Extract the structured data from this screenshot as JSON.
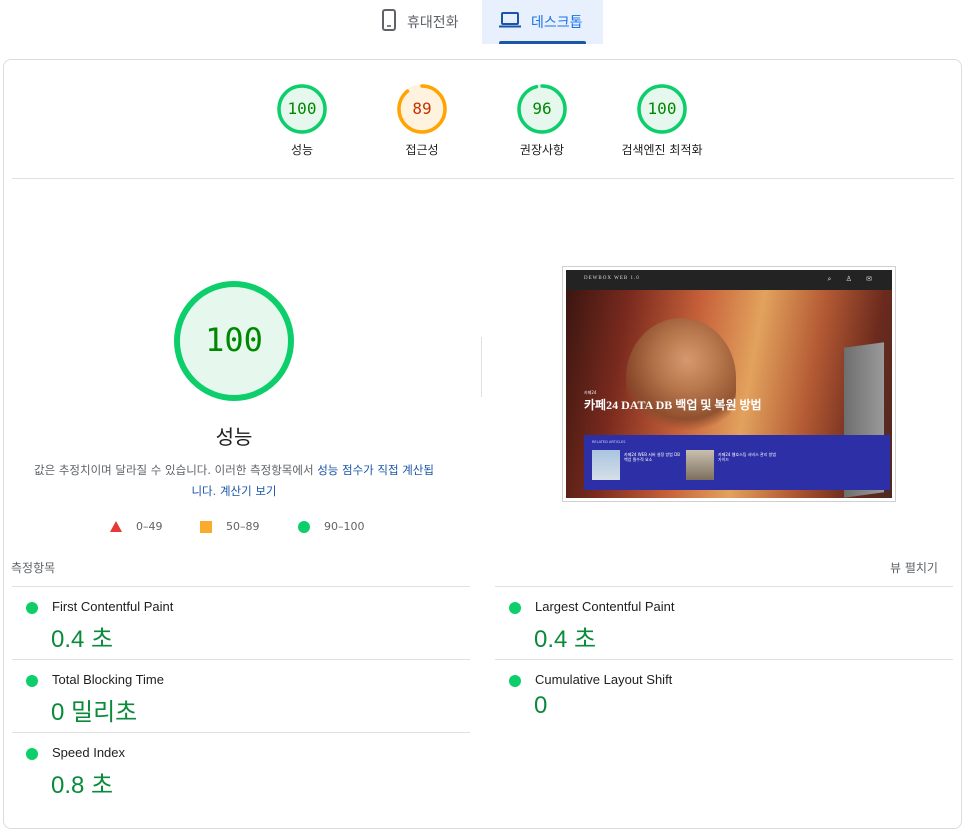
{
  "tabs": [
    {
      "label": "휴대전화",
      "icon": "mobile-phone-icon",
      "selected": false
    },
    {
      "label": "데스크톱",
      "icon": "laptop-icon",
      "selected": true
    }
  ],
  "gauges": [
    {
      "value": "100",
      "label": "성능",
      "color": "#0cce6b",
      "track": "#e6f8ee",
      "text": "#008800",
      "fraction": 1.0
    },
    {
      "value": "89",
      "label": "접근성",
      "color": "#ffa400",
      "track": "#fff3e0",
      "text": "#c33300",
      "fraction": 0.89
    },
    {
      "value": "96",
      "label": "권장사항",
      "color": "#0cce6b",
      "track": "#e6f8ee",
      "text": "#008800",
      "fraction": 0.96
    },
    {
      "value": "100",
      "label": "검색엔진 최적화",
      "color": "#0cce6b",
      "track": "#e6f8ee",
      "text": "#008800",
      "fraction": 1.0
    }
  ],
  "performance": {
    "score": "100",
    "title": "성능",
    "desc_text": "값은 추정치이며 달라질 수 있습니다. 이러한 측정항목에서 ",
    "desc_link1": "성능 점수가 직접 계산됩니다",
    "desc_dot": ". ",
    "desc_link2": "계산기 보기"
  },
  "legend": {
    "fail": "0–49",
    "average": "50–89",
    "pass": "90–100"
  },
  "screenshot": {
    "logo": "DEWBOX WEB 1.0",
    "category": "카페24",
    "title": "카페24 DATA DB 백업 및 복원 방법",
    "panel_label": "RELATED ARTICLES",
    "item1": "카페24 WEB 서버 설정 방법 DB 백업 필수적 요소",
    "item2": "카페24 웹호스팅 서비스 관리 방법 가이드"
  },
  "metrics": {
    "header": "측정항목",
    "expand_label": "뷰 펼치기",
    "items": [
      {
        "name": "First Contentful Paint",
        "value": "0.4 초"
      },
      {
        "name": "Largest Contentful Paint",
        "value": "0.4 초"
      },
      {
        "name": "Total Blocking Time",
        "value": "0 밀리초"
      },
      {
        "name": "Cumulative Layout Shift",
        "value": "0"
      },
      {
        "name": "Speed Index",
        "value": "0.8 초"
      }
    ]
  }
}
